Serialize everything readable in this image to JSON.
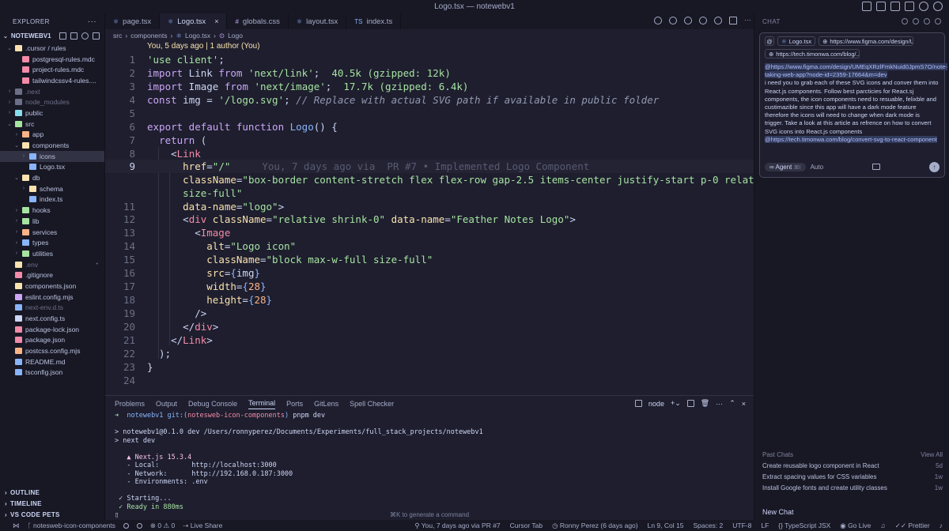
{
  "window": {
    "title": "Logo.tsx — notewebv1"
  },
  "explorer": {
    "header": "EXPLORER",
    "root": "NOTEWEBV1",
    "items": [
      {
        "label": ".cursor / rules",
        "depth": 1,
        "type": "folder-open",
        "color": "#f9e2af"
      },
      {
        "label": "postgresql-rules.mdc",
        "depth": 2,
        "type": "file",
        "color": "#f38ba8"
      },
      {
        "label": "project-rules.mdc",
        "depth": 2,
        "type": "file",
        "color": "#f38ba8"
      },
      {
        "label": "tailwindcssv4-rules....",
        "depth": 2,
        "type": "file",
        "color": "#f38ba8"
      },
      {
        "label": ".next",
        "depth": 1,
        "type": "folder",
        "color": "#6c7086",
        "dim": true
      },
      {
        "label": "node_modules",
        "depth": 1,
        "type": "folder",
        "color": "#6c7086",
        "dim": true
      },
      {
        "label": "public",
        "depth": 1,
        "type": "folder",
        "color": "#89dceb"
      },
      {
        "label": "src",
        "depth": 1,
        "type": "folder-open",
        "color": "#a6e3a1"
      },
      {
        "label": "app",
        "depth": 2,
        "type": "folder",
        "color": "#fab387"
      },
      {
        "label": "components",
        "depth": 2,
        "type": "folder-open",
        "color": "#f9e2af"
      },
      {
        "label": "icons",
        "depth": 3,
        "type": "folder",
        "color": "#89b4fa",
        "selected": true
      },
      {
        "label": "Logo.tsx",
        "depth": 3,
        "type": "file",
        "color": "#89b4fa"
      },
      {
        "label": "db",
        "depth": 2,
        "type": "folder-open",
        "color": "#f9e2af"
      },
      {
        "label": "schema",
        "depth": 3,
        "type": "folder",
        "color": "#f9e2af"
      },
      {
        "label": "index.ts",
        "depth": 3,
        "type": "file",
        "color": "#89b4fa"
      },
      {
        "label": "hooks",
        "depth": 2,
        "type": "folder",
        "color": "#a6e3a1"
      },
      {
        "label": "lib",
        "depth": 2,
        "type": "folder",
        "color": "#a6e3a1"
      },
      {
        "label": "services",
        "depth": 2,
        "type": "folder",
        "color": "#fab387"
      },
      {
        "label": "types",
        "depth": 2,
        "type": "folder",
        "color": "#89b4fa"
      },
      {
        "label": "utilities",
        "depth": 2,
        "type": "folder",
        "color": "#a6e3a1"
      },
      {
        "label": ".env",
        "depth": 1,
        "type": "file",
        "color": "#f9e2af",
        "dim": true,
        "git": "•"
      },
      {
        "label": ".gitignore",
        "depth": 1,
        "type": "file",
        "color": "#f38ba8"
      },
      {
        "label": "components.json",
        "depth": 1,
        "type": "file",
        "color": "#f9e2af"
      },
      {
        "label": "eslint.config.mjs",
        "depth": 1,
        "type": "file",
        "color": "#cba6f7"
      },
      {
        "label": "next-env.d.ts",
        "depth": 1,
        "type": "file",
        "color": "#89b4fa",
        "dim": true
      },
      {
        "label": "next.config.ts",
        "depth": 1,
        "type": "file",
        "color": "#cdd6f4"
      },
      {
        "label": "package-lock.json",
        "depth": 1,
        "type": "file",
        "color": "#f38ba8"
      },
      {
        "label": "package.json",
        "depth": 1,
        "type": "file",
        "color": "#f38ba8"
      },
      {
        "label": "postcss.config.mjs",
        "depth": 1,
        "type": "file",
        "color": "#fab387"
      },
      {
        "label": "README.md",
        "depth": 1,
        "type": "file",
        "color": "#89b4fa"
      },
      {
        "label": "tsconfig.json",
        "depth": 1,
        "type": "file",
        "color": "#89b4fa"
      }
    ],
    "sections": [
      "OUTLINE",
      "TIMELINE",
      "VS CODE PETS"
    ]
  },
  "tabs": [
    {
      "label": "page.tsx",
      "active": false
    },
    {
      "label": "Logo.tsx",
      "active": true
    },
    {
      "label": "globals.css",
      "active": false
    },
    {
      "label": "layout.tsx",
      "active": false
    },
    {
      "label": "index.ts",
      "active": false
    }
  ],
  "breadcrumb": [
    "src",
    "components",
    "Logo.tsx",
    "Logo"
  ],
  "editor": {
    "blame_header": "You, 5 days ago | 1 author (You)",
    "current_line_blame": "You, 7 days ago via  PR #7 • Implemented Logo Component",
    "line_numbers": [
      "1",
      "2",
      "3",
      "4",
      "5",
      "6",
      "7",
      "8",
      "9",
      "",
      "11",
      "12",
      "13",
      "14",
      "15",
      "16",
      "17",
      "18",
      "19",
      "20",
      "21",
      "22",
      "23",
      "24"
    ]
  },
  "panel": {
    "tabs": [
      "Problems",
      "Output",
      "Debug Console",
      "Terminal",
      "Ports",
      "GitLens",
      "Spell Checker"
    ],
    "active_tab": "Terminal",
    "terminal_name": "node",
    "lines": [
      "➜  notewebv1 git:(notesweb-icon-components) pnpm dev",
      "",
      "> notewebv1@0.1.0 dev /Users/ronnyperez/Documents/Experiments/full_stack_projects/notewebv1",
      "> next dev",
      "",
      "   ▲ Next.js 15.3.4",
      "   - Local:        http://localhost:3000",
      "   - Network:      http://192.168.0.187:3000",
      "   - Environments: .env",
      "",
      " ✓ Starting...",
      " ✓ Ready in 880ms",
      "▯"
    ],
    "generate_hint": "⌘K to generate a command"
  },
  "chat": {
    "header": "CHAT",
    "chips": [
      "Logo.tsx",
      "https://www.figma.com/design/U...",
      "https://tech.timonwa.com/blog/..."
    ],
    "mention1": "@https://www.figma.com/design/UMEqXRzlFmkNuid0JpmS7O/note-taking-web-app?node-id=2359-17664&m=dev",
    "body": "i need you to grab each of these SVG icons and conver them into React.js components. Follow best parcticies for React.sj components, the icon components need to resuable, felixble and custimazible since this app will have a dark mode feature therefore the icons will need to change when dark mode is trigger. Take a look at this article as refrence on how to convert SVG icons into React.js components",
    "mention2": "@https://tech.timonwa.com/blog/convert-svg-to-react-component",
    "agent_label": "Agent",
    "agent_shortcut": "⌘I",
    "mode_label": "Auto",
    "past_title": "Past Chats",
    "view_all": "View All",
    "past": [
      {
        "title": "Create reusable logo component in React",
        "age": "5d"
      },
      {
        "title": "Extract spacing values for CSS variables",
        "age": "1w"
      },
      {
        "title": "Install Google fonts and create utility classes",
        "age": "1w"
      }
    ],
    "new_chat": "New Chat"
  },
  "statusbar": {
    "branch": "notesweb-icon-components",
    "problems": "⊗ 0 ⚠ 0",
    "live_share": "Live Share",
    "blame": "You, 7 days ago via  PR #7",
    "cursor_tab": "Cursor Tab",
    "author": "Ronny Perez (6 days ago)",
    "position": "Ln 9, Col 15",
    "spaces": "Spaces: 2",
    "encoding": "UTF-8",
    "eol": "LF",
    "language": "TypeScript JSX",
    "go_live": "Go Live",
    "prettier": "Prettier"
  }
}
